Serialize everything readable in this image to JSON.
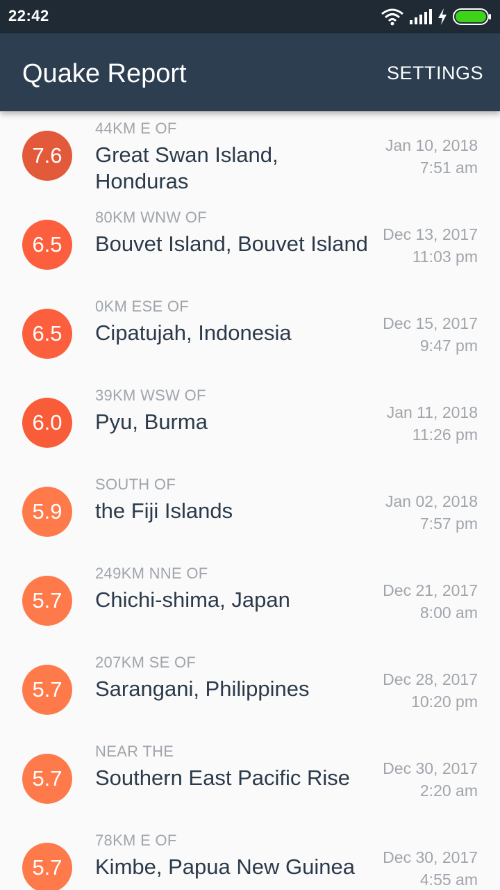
{
  "status_bar": {
    "time": "22:42",
    "icons": [
      "wifi-icon",
      "signal-icon",
      "charging-icon",
      "battery-icon"
    ],
    "battery_color": "#3ed31a"
  },
  "app_bar": {
    "title": "Quake Report",
    "settings_label": "SETTINGS",
    "background": "#2c3e50"
  },
  "quakes": [
    {
      "mag": "7.6",
      "color": "#e35a3a",
      "offset": "44KM E OF",
      "location": "Great Swan Island, Honduras",
      "date": "Jan 10, 2018",
      "time": "7:51 am"
    },
    {
      "mag": "6.5",
      "color": "#fb5f3d",
      "offset": "80KM WNW OF",
      "location": "Bouvet Island, Bouvet Island",
      "date": "Dec 13, 2017",
      "time": "11:03 pm"
    },
    {
      "mag": "6.5",
      "color": "#fb5f3d",
      "offset": "0KM ESE OF",
      "location": "Cipatujah, Indonesia",
      "date": "Dec 15, 2017",
      "time": "9:47 pm"
    },
    {
      "mag": "6.0",
      "color": "#f95c38",
      "offset": "39KM WSW OF",
      "location": "Pyu, Burma",
      "date": "Jan 11, 2018",
      "time": "11:26 pm"
    },
    {
      "mag": "5.9",
      "color": "#ff7a4a",
      "offset": "SOUTH OF",
      "location": "the Fiji Islands",
      "date": "Jan 02, 2018",
      "time": "7:57 pm"
    },
    {
      "mag": "5.7",
      "color": "#ff7a4a",
      "offset": "249KM NNE OF",
      "location": "Chichi-shima, Japan",
      "date": "Dec 21, 2017",
      "time": "8:00 am"
    },
    {
      "mag": "5.7",
      "color": "#ff7a4a",
      "offset": "207KM SE OF",
      "location": "Sarangani, Philippines",
      "date": "Dec 28, 2017",
      "time": "10:20 pm"
    },
    {
      "mag": "5.7",
      "color": "#ff7a4a",
      "offset": "NEAR THE",
      "location": "Southern East Pacific Rise",
      "date": "Dec 30, 2017",
      "time": "2:20 am"
    },
    {
      "mag": "5.7",
      "color": "#ff7a4a",
      "offset": "78KM E OF",
      "location": "Kimbe, Papua New Guinea",
      "date": "Dec 30, 2017",
      "time": "4:55 am"
    }
  ]
}
